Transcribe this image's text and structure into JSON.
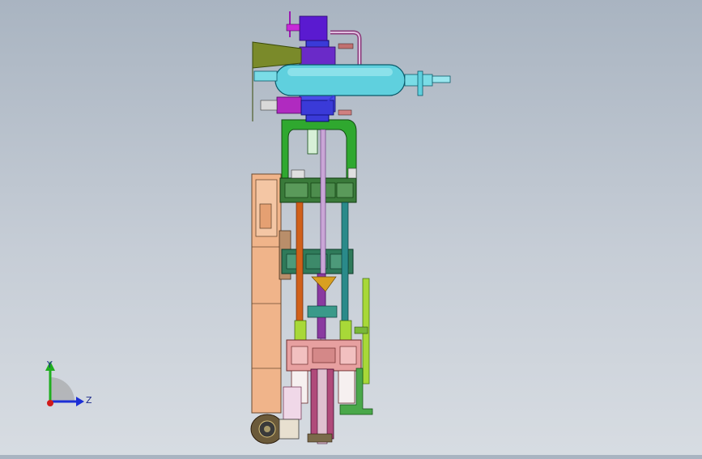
{
  "viewport": {
    "background_top": "#a9b4c1",
    "background_bottom": "#d7dce2"
  },
  "triad": {
    "y_label": "Y",
    "z_label": "Z",
    "y_color": "#1fae1f",
    "z_color": "#1c2fd6",
    "origin_color": "#d11a1a"
  },
  "model": {
    "colors": {
      "tank": "#5fd0de",
      "frame_green": "#2fa82f",
      "upper_block": "#3a7a3a",
      "cylinder_blue": "#3a3ad8",
      "housing_peach": "#f0b48a",
      "cone_olive": "#7a8a2a",
      "pump_purple": "#9a2ab0",
      "rod_orange": "#d0601a",
      "rod_teal": "#2a8a8a",
      "rod_violet": "#8a3aa0",
      "base_pink": "#e7a0a0",
      "yellow_green": "#a8d838"
    }
  }
}
